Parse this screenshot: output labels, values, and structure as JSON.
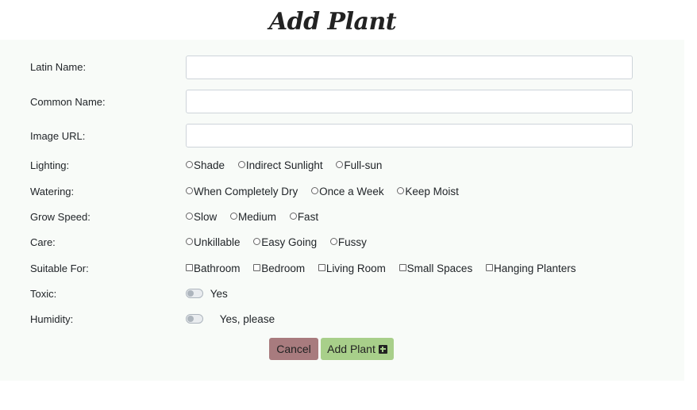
{
  "page_title": "Add Plant",
  "fields": {
    "latin_name": {
      "label": "Latin Name:",
      "value": ""
    },
    "common_name": {
      "label": "Common Name:",
      "value": ""
    },
    "image_url": {
      "label": "Image URL:",
      "value": ""
    }
  },
  "lighting": {
    "label": "Lighting:",
    "options": [
      "Shade",
      "Indirect Sunlight",
      "Full-sun"
    ]
  },
  "watering": {
    "label": "Watering:",
    "options": [
      "When Completely Dry",
      "Once a Week",
      "Keep Moist"
    ]
  },
  "grow_speed": {
    "label": "Grow Speed:",
    "options": [
      "Slow",
      "Medium",
      "Fast"
    ]
  },
  "care": {
    "label": "Care:",
    "options": [
      "Unkillable",
      "Easy Going",
      "Fussy"
    ]
  },
  "suitable_for": {
    "label": "Suitable For:",
    "options": [
      "Bathroom",
      "Bedroom",
      "Living Room",
      "Small Spaces",
      "Hanging Planters"
    ]
  },
  "toxic": {
    "label": "Toxic:",
    "toggle_label": "Yes",
    "on": false
  },
  "humidity": {
    "label": "Humidity:",
    "toggle_label": "Yes, please",
    "on": false
  },
  "buttons": {
    "cancel": "Cancel",
    "add": "Add Plant"
  },
  "icons": {
    "add_icon": "plus-square-icon"
  },
  "colors": {
    "cancel_bg": "#a87b7e",
    "add_bg": "#a8cf8a",
    "card_bg": "#f8fbf8"
  }
}
